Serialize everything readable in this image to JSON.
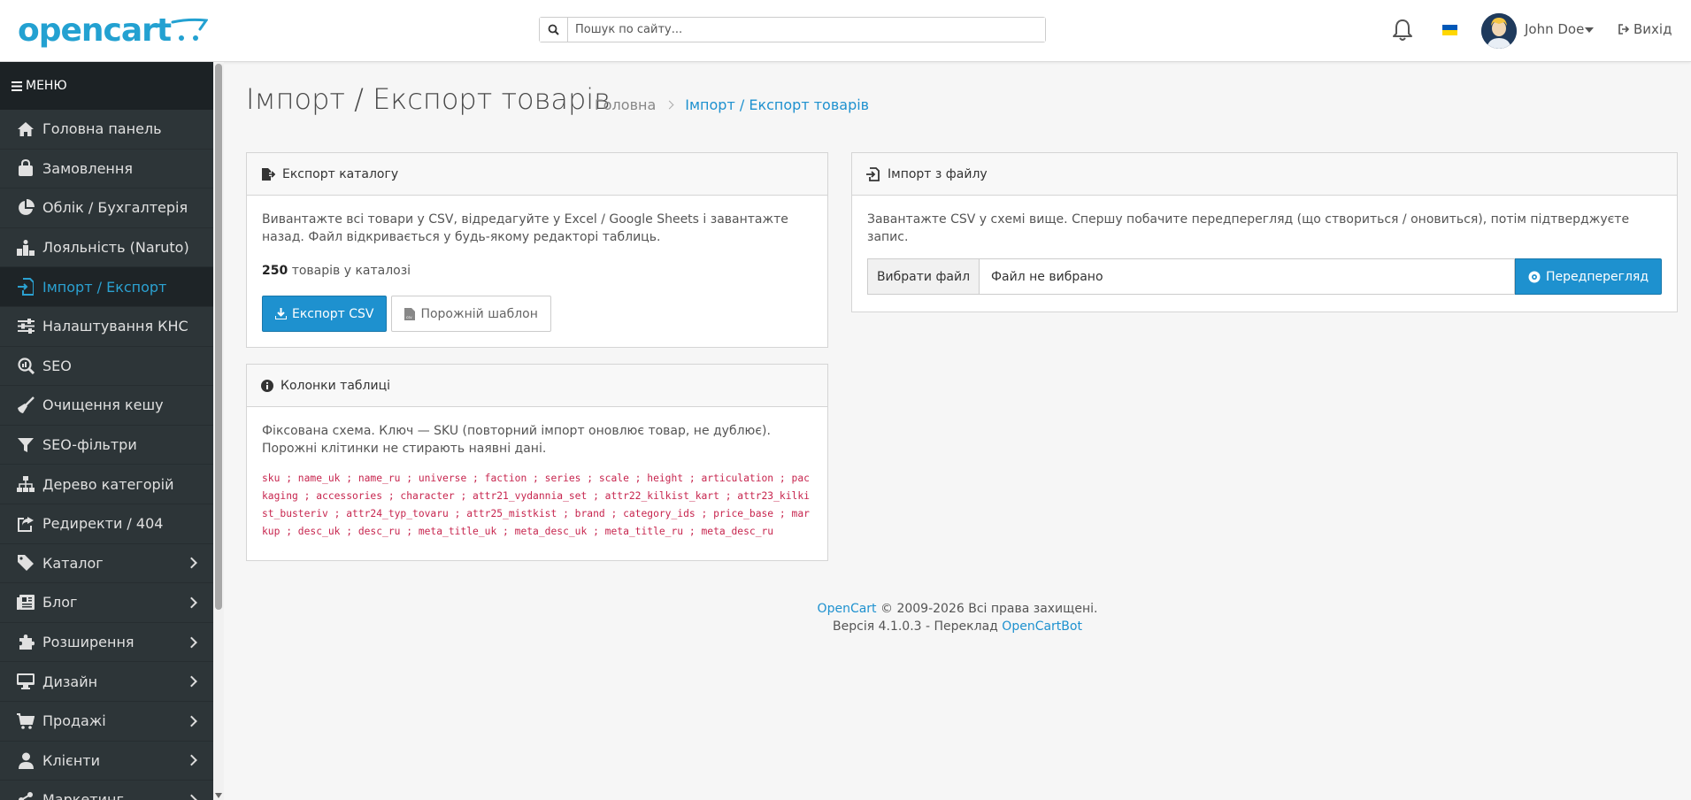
{
  "header": {
    "logo": "opencart",
    "search_placeholder": "Пошук по сайту...",
    "user_name": "John Doe",
    "logout_label": "Вихід",
    "flag_colors": [
      "#0057b7",
      "#ffd700"
    ]
  },
  "sidebar": {
    "menu_title": "МЕНЮ",
    "items": [
      {
        "label": "Головна панель",
        "icon": "home-icon"
      },
      {
        "label": "Замовлення",
        "icon": "shopping-bag-icon"
      },
      {
        "label": "Облік / Бухгалтерія",
        "icon": "pie-chart-icon"
      },
      {
        "label": "Лояльність (Naruto)",
        "icon": "podium-icon"
      },
      {
        "label": "Імпорт / Експорт",
        "icon": "file-import-icon",
        "active": true
      },
      {
        "label": "Налаштування КНС",
        "icon": "sliders-icon"
      },
      {
        "label": "SEO",
        "icon": "magnifier-chart-icon"
      },
      {
        "label": "Очищення кешу",
        "icon": "broom-icon"
      },
      {
        "label": "SEO-фільтри",
        "icon": "filter-icon"
      },
      {
        "label": "Дерево категорій",
        "icon": "sitemap-icon"
      },
      {
        "label": "Редиректи / 404",
        "icon": "share-square-icon"
      },
      {
        "label": "Каталог",
        "icon": "tag-icon",
        "submenu": true
      },
      {
        "label": "Блог",
        "icon": "newspaper-icon",
        "submenu": true
      },
      {
        "label": "Розширення",
        "icon": "puzzle-icon",
        "submenu": true
      },
      {
        "label": "Дизайн",
        "icon": "desktop-icon",
        "submenu": true
      },
      {
        "label": "Продажі",
        "icon": "cart-icon",
        "submenu": true
      },
      {
        "label": "Клієнти",
        "icon": "user-icon",
        "submenu": true
      },
      {
        "label": "Маркетинг",
        "icon": "share-icon",
        "submenu": true
      }
    ]
  },
  "page": {
    "title": "Імпорт / Експорт товарів",
    "breadcrumb_home": "Головна",
    "breadcrumb_current": "Імпорт / Експорт товарів"
  },
  "export_card": {
    "title": "Експорт каталогу",
    "description": "Вивантажте всі товари у CSV, відредагуйте у Excel / Google Sheets і завантажте назад. Файл відкривається у будь-якому редакторі таблиць.",
    "count": "250",
    "count_suffix": "товарів у каталозі",
    "export_button": "Експорт CSV",
    "template_button": "Порожній шаблон"
  },
  "columns_card": {
    "title": "Колонки таблиці",
    "description": "Фіксована схема. Ключ — SKU (повторний імпорт оновлює товар, не дублює). Порожні клітинки не стирають наявні дані.",
    "schema": "sku ; name_uk ; name_ru ; universe ; faction ; series ; scale ; height ; articulation ; packaging ; accessories ; character ; attr21_vydannia_set ; attr22_kilkist_kart ; attr23_kilkist_busteriv ; attr24_typ_tovaru ; attr25_mistkist ; brand ; category_ids ; price_base ; markup ; desc_uk ; desc_ru ; meta_title_uk ; meta_desc_uk ; meta_title_ru ; meta_desc_ru"
  },
  "import_card": {
    "title": "Імпорт з файлу",
    "description": "Завантажте CSV у схемі вище. Спершу побачите передперегляд (що створиться / оновиться), потім підтверджуєте запис.",
    "choose_file": "Вибрати файл",
    "no_file": "Файл не вибрано",
    "preview_button": "Передперегляд"
  },
  "footer": {
    "brand": "OpenCart",
    "copyright": "© 2009-2026 Всі права захищені.",
    "version": "Версія 4.1.0.3 - Переклад",
    "translator": "OpenCartBot"
  }
}
